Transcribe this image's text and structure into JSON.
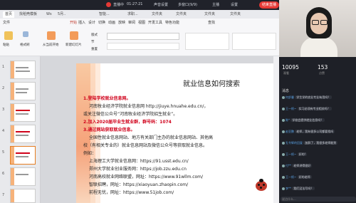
{
  "topbar": {
    "status": "直播中",
    "time": "01:27:21",
    "items": [
      "声音设置",
      "多窗口(9/9)",
      "主播",
      "设置"
    ],
    "stop_label": "结束直播"
  },
  "wps": {
    "tabs": [
      "首页",
      "找稻壳模板",
      "Ws",
      "5月..",
      "智能...",
      "求职...",
      "文件夹",
      "文件夹",
      "文件夹",
      "文件夹"
    ],
    "menus": [
      "文件",
      "开始",
      "插入",
      "设计",
      "切换",
      "动画",
      "放映",
      "审阅",
      "视图",
      "开发工具",
      "特色功能",
      "查找"
    ],
    "active_menu": "开始",
    "toolbar": {
      "paste": "粘贴",
      "format": "格式刷",
      "from_current": "从当前开始",
      "new_slide": "新建幻灯片",
      "layout": "版式",
      "section": "节",
      "reset": "重置"
    }
  },
  "slides": {
    "numbers": [
      "1",
      "2",
      "3",
      "4",
      "5",
      "6",
      "7"
    ]
  },
  "slide": {
    "title": "就业信息如何搜索",
    "h1": "1.登陆学校就业信息网。",
    "l1": "河南牧业经济学院就业信息网 http://jiuye.hnuahe.edu.cn/，",
    "l2": "或关注微信公众号“河南牧业经济学院招生就业”。",
    "h2": "2.加入2020届毕业生就业群，群号码：1074",
    "h3": "3.通过网站获取就业信息。",
    "l3": "全国性就业信息网站、地方有关部门主办的就业信息网站、其他高",
    "l4": "校（有相关专业的）就业信息网站及微信公众号等获取就业信息。",
    "l5": "例如：",
    "l6": "上海理工大学就业信息网：https://91.usst.edu.cn/",
    "l7": "郑州大学就业创业服务网：https://job.zzu.edu.cn",
    "l8": "河南高校就业网络联盟，网址：https://www.91wllm.com/",
    "l9": "智联招聘，网址：https://xiaoyuan.zhaopin.com/",
    "l10": "前程无忧，网址：https://www.51job.com/"
  },
  "stats": {
    "viewers": "10095",
    "viewers_label": "观看",
    "likes": "153",
    "likes_label": "点赞"
  },
  "chat": {
    "header": "消息",
    "messages": [
      {
        "name": "何舒曼",
        "text": "学生学的农业专业有用吗？"
      },
      {
        "name": "王一帆~",
        "text": "实习必须有专业相关吗？"
      },
      {
        "name": "陈*",
        "text": "学校会提供就业信息吗？"
      },
      {
        "name": "赵亚鹏",
        "text": "老师，我有很多公司都要找吗"
      },
      {
        "name": "孔令辉的回复",
        "text": "加群了，我很多老师能到"
      },
      {
        "name": "王一帆~",
        "text": "好的!"
      },
      {
        "name": "付**",
        "text": "老师讲得很好"
      },
      {
        "name": "王一帆~",
        "text": "好的老师"
      },
      {
        "name": "李**",
        "text": "我们没法写吗？"
      }
    ],
    "input_placeholder": "说点什么..."
  },
  "colors": {
    "accent": "#d0021b",
    "record": "#e53935"
  }
}
